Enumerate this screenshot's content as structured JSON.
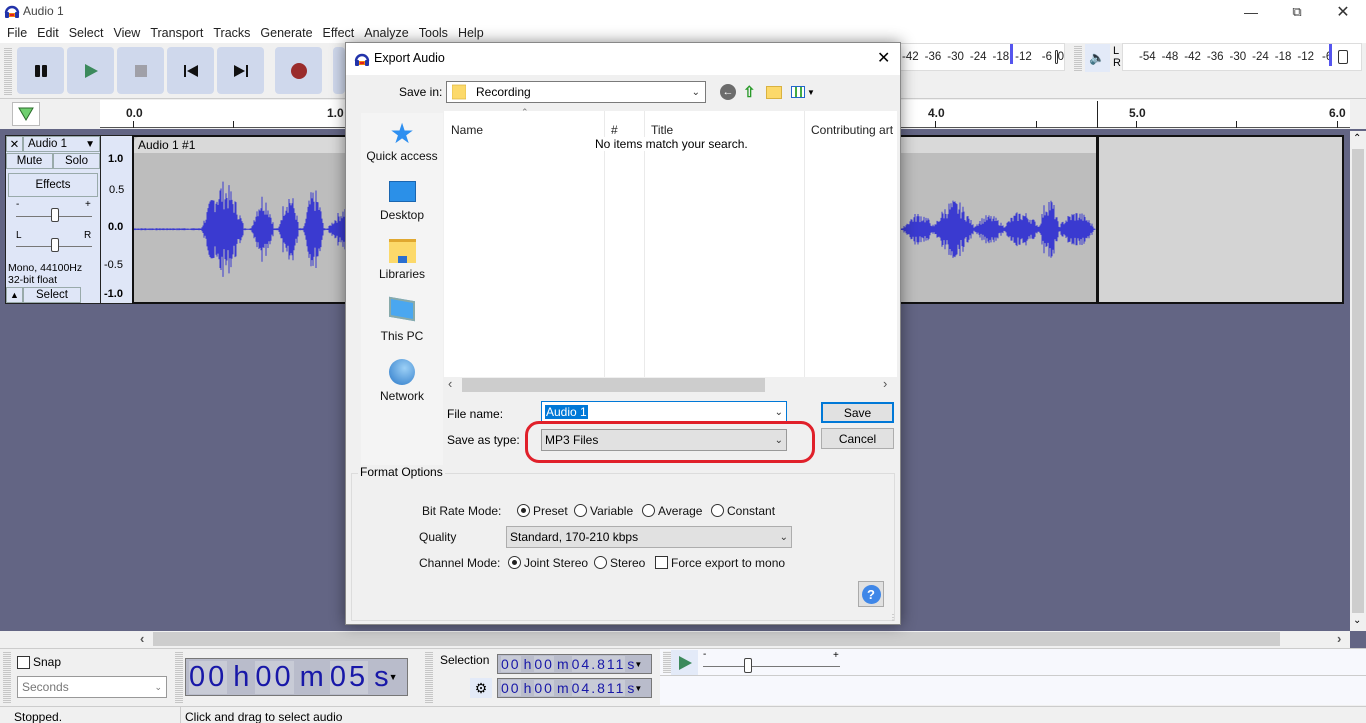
{
  "window": {
    "title": "Audio 1"
  },
  "menu": [
    "File",
    "Edit",
    "Select",
    "View",
    "Transport",
    "Tracks",
    "Generate",
    "Effect",
    "Analyze",
    "Tools",
    "Help"
  ],
  "transport": {
    "buttons": [
      "pause",
      "play",
      "stop",
      "skip-to-start",
      "skip-to-end",
      "record"
    ],
    "colors": {
      "play": "#3c8a5c",
      "record": "#9a2c2c",
      "button_bg": "#cfd8ec"
    }
  },
  "meters": {
    "recording_ticks": [
      "-42",
      "-36",
      "-30",
      "-24",
      "-18",
      "-12",
      "-6",
      "0"
    ],
    "playback_ticks": [
      "-54",
      "-48",
      "-42",
      "-36",
      "-30",
      "-24",
      "-18",
      "-12",
      "-6"
    ],
    "channels": [
      "L",
      "R"
    ]
  },
  "timeline": {
    "ticks": [
      "0.0",
      "1.0",
      "4.0",
      "5.0",
      "6.0"
    ]
  },
  "track": {
    "name": "Audio 1",
    "mute_label": "Mute",
    "solo_label": "Solo",
    "effects_label": "Effects",
    "gain_min": "-",
    "gain_max": "+",
    "pan_left": "L",
    "pan_right": "R",
    "info_line1": "Mono, 44100Hz",
    "info_line2": "32-bit float",
    "select_label": "Select",
    "clip_name": "Audio 1 #1",
    "vruler": [
      "1.0",
      "0.5",
      "0.0",
      "-0.5",
      "-1.0"
    ],
    "waveform_color": "#3a3ad0"
  },
  "dialog": {
    "title": "Export Audio",
    "save_in_label": "Save in:",
    "save_in_value": "Recording",
    "places": [
      "Quick access",
      "Desktop",
      "Libraries",
      "This PC",
      "Network"
    ],
    "columns": [
      "Name",
      "#",
      "Title",
      "Contributing art"
    ],
    "empty_message": "No items match your search.",
    "file_name_label": "File name:",
    "file_name_value": "Audio 1",
    "save_type_label": "Save as type:",
    "save_type_value": "MP3 Files",
    "save_button": "Save",
    "cancel_button": "Cancel",
    "format_options": {
      "legend": "Format Options",
      "bit_rate_label": "Bit Rate Mode:",
      "bit_rate_options": [
        "Preset",
        "Variable",
        "Average",
        "Constant"
      ],
      "bit_rate_selected": "Preset",
      "quality_label": "Quality",
      "quality_value": "Standard, 170-210 kbps",
      "channel_label": "Channel Mode:",
      "channel_options": [
        "Joint Stereo",
        "Stereo"
      ],
      "channel_selected": "Joint Stereo",
      "force_mono_label": "Force export to mono",
      "force_mono_checked": false
    },
    "highlight_color": "#e0202a"
  },
  "bottom": {
    "snap_label": "Snap",
    "snap_checked": false,
    "snap_unit": "Seconds",
    "audio_position": {
      "h": "00",
      "m": "00",
      "s": "05"
    },
    "selection_label": "Selection",
    "selection_start": {
      "h": "00",
      "m": "00",
      "s": "04.811"
    },
    "selection_end": {
      "h": "00",
      "m": "00",
      "s": "04.811"
    },
    "play_speed_min": "-",
    "play_speed_max": "+"
  },
  "status": {
    "left": "Stopped.",
    "right": "Click and drag to select audio"
  }
}
